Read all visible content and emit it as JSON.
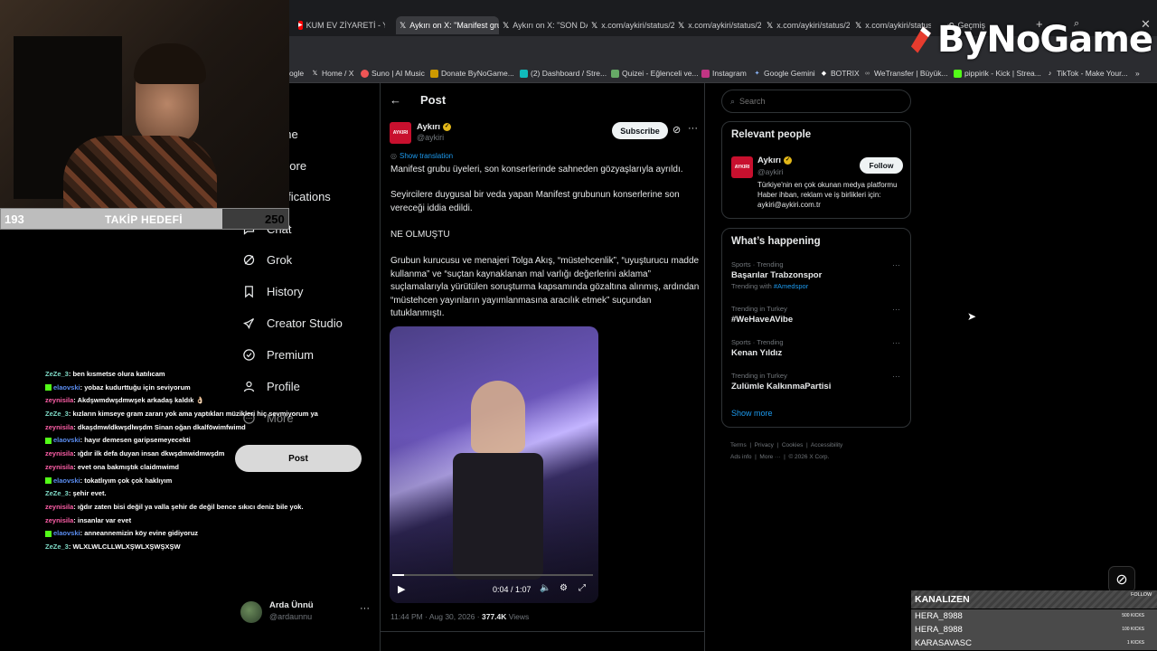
{
  "browser": {
    "tabs": [
      {
        "label": "KUM EV ZİYARETİ - Yo",
        "favicon": "youtube-icon"
      },
      {
        "label": "Aykırı on X: \"Manifest grub",
        "favicon": "x-icon",
        "active": true
      },
      {
        "label": "Aykırı on X: \"SON DAK",
        "favicon": "x-icon"
      },
      {
        "label": "x.com/aykiri/status/20",
        "favicon": "x-icon"
      },
      {
        "label": "x.com/aykiri/status/20",
        "favicon": "x-icon"
      },
      {
        "label": "x.com/aykiri/status/20",
        "favicon": "x-icon"
      },
      {
        "label": "x.com/aykiri/status/20",
        "favicon": "x-icon"
      },
      {
        "label": "Geçmiş",
        "favicon": "history-icon"
      }
    ],
    "bookmarks": [
      {
        "label": "ogle"
      },
      {
        "label": "Home / X"
      },
      {
        "label": "Suno | AI Music"
      },
      {
        "label": "Donate ByNoGame..."
      },
      {
        "label": "(2) Dashboard / Stre..."
      },
      {
        "label": "Quizei - Eğlenceli ve..."
      },
      {
        "label": "Instagram"
      },
      {
        "label": "Google Gemini"
      },
      {
        "label": "BOTRIX"
      },
      {
        "label": "WeTransfer | Büyük..."
      },
      {
        "label": "pippirik - Kick | Strea..."
      },
      {
        "label": "TikTok - Make Your..."
      }
    ]
  },
  "overlay": {
    "brand": "ByNoGame",
    "goal": {
      "current": "193",
      "label": "TAKİP HEDEFİ",
      "target": "250",
      "progress": 0.772
    },
    "chat": [
      {
        "user": "ZeZe_3",
        "color": "#7fdcc8",
        "text": ": ben kısmetse olura katılıcam",
        "badge": false
      },
      {
        "user": "elaovski",
        "color": "#5b8df0",
        "text": ": yobaz kudurttuğu için seviyorum",
        "badge": true
      },
      {
        "user": "zeynisila",
        "color": "#ff5fa8",
        "text": ": Akdşwmdwşdmwşek arkadaş kaldık 👌🏻",
        "badge": false
      },
      {
        "user": "ZeZe_3",
        "color": "#7fdcc8",
        "text": ": kızların kimseye gram zararı yok ama yaptıkları müzikleri hiç sevmiyorum ya",
        "badge": false
      },
      {
        "user": "zeynisila",
        "color": "#ff5fa8",
        "text": ": dkaşdmwldkwşdlwşdm Sinan oğan dkalföwimfwimd",
        "badge": false
      },
      {
        "user": "elaovski",
        "color": "#5b8df0",
        "text": ": hayır demesen garipsemeyecekti",
        "badge": true
      },
      {
        "user": "zeynisila",
        "color": "#ff5fa8",
        "text": ": ığdır ilk defa duyan insan dkwşdmwidmwşdm",
        "badge": false
      },
      {
        "user": "zeynisila",
        "color": "#ff5fa8",
        "text": ": evet ona bakmıştık claidmwimd",
        "badge": false
      },
      {
        "user": "elaovski",
        "color": "#5b8df0",
        "text": ": tokatlıyım çok çok haklıyım",
        "badge": true
      },
      {
        "user": "ZeZe_3",
        "color": "#7fdcc8",
        "text": ": şehir evet.",
        "badge": false
      },
      {
        "user": "zeynisila",
        "color": "#ff5fa8",
        "text": ": ığdır zaten bisi değil ya valla şehir de değil bence sıkıcı deniz bile yok.",
        "badge": false
      },
      {
        "user": "zeynisila",
        "color": "#ff5fa8",
        "text": ": insanlar var evet",
        "badge": false
      },
      {
        "user": "elaovski",
        "color": "#5b8df0",
        "text": ": anneannemizin köy evine gidiyoruz",
        "badge": true
      },
      {
        "user": "ZeZe_3",
        "color": "#7fdcc8",
        "text": ": WLXLWLCLLWLXŞWLXŞWŞXŞW",
        "badge": false
      }
    ],
    "kick": {
      "title": "KANALIZEN",
      "follow_label": "FOLLOW",
      "rows": [
        {
          "name": "HERA_8988",
          "amount": "500 KICKS"
        },
        {
          "name": "HERA_8988",
          "amount": "100 KICKS"
        },
        {
          "name": "KARASAVASC",
          "amount": "1 KICKS"
        }
      ]
    }
  },
  "x": {
    "nav": [
      {
        "label": "Home",
        "icon": "home-icon"
      },
      {
        "label": "Explore",
        "icon": "search-icon"
      },
      {
        "label": "Notifications",
        "icon": "bell-icon"
      },
      {
        "label": "Chat",
        "icon": "chat-icon"
      },
      {
        "label": "Grok",
        "icon": "grok-icon"
      },
      {
        "label": "History",
        "icon": "bookmark-icon"
      },
      {
        "label": "Creator Studio",
        "icon": "rocket-icon"
      },
      {
        "label": "Premium",
        "icon": "verified-icon"
      },
      {
        "label": "Profile",
        "icon": "person-icon"
      },
      {
        "label": "More",
        "icon": "more-icon"
      }
    ],
    "post_button": "Post",
    "account": {
      "name": "Arda Ünnü",
      "handle": "@ardaunnu"
    },
    "main": {
      "header": "Post",
      "author": {
        "name": "Aykırı",
        "handle": "@aykiri",
        "avatar_text": "AYKIRI"
      },
      "subscribe": "Subscribe",
      "show_translation": "Show translation",
      "paragraphs": [
        "Manifest grubu üyeleri, son konserlerinde sahneden gözyaşlarıyla ayrıldı.",
        "Seyircilere duygusal bir veda yapan Manifest grubunun konserlerine son vereceği iddia edildi.",
        "NE OLMUŞTU",
        "Grubun kurucusu ve menajeri Tolga Akış, “müstehcenlik”, “uyuşturucu madde kullanma” ve “suçtan kaynaklanan mal varlığı değerlerini aklama” suçlamalarıyla yürütülen soruşturma kapsamında gözaltına alınmış, ardından “müstehcen yayınların yayımlanmasına aracılık etmek” suçundan tutuklanmıştı."
      ],
      "video": {
        "time": "0:04 / 1:07",
        "progress": 0.06
      },
      "meta_time": "11:44 PM · Aug 30, 2026 ·",
      "views_count": "377.4K",
      "views_label": "Views"
    },
    "right": {
      "search_placeholder": "Search",
      "relevant_title": "Relevant people",
      "relevant": {
        "name": "Aykırı",
        "handle": "@aykiri",
        "follow": "Follow",
        "bio": "Türkiye'nin en çok okunan medya platformu Haber ihban, reklam ve iş birlikleri için: aykiri@aykiri.com.tr"
      },
      "happening_title": "What’s happening",
      "trends": [
        {
          "meta": "Sports · Trending",
          "name": "Başarılar Trabzonspor",
          "extra_prefix": "Trending with",
          "extra_tag": "#Amedspor"
        },
        {
          "meta": "Trending in Turkey",
          "name": "#WeHaveAVibe"
        },
        {
          "meta": "Sports · Trending",
          "name": "Kenan Yıldız"
        },
        {
          "meta": "Trending in Turkey",
          "name": "Zulümle KalkınmaPartisi"
        }
      ],
      "show_more": "Show more",
      "footer": [
        "Terms",
        "Privacy",
        "Cookies",
        "Accessibility",
        "Ads info",
        "More ···",
        "© 2026 X Corp."
      ]
    }
  }
}
